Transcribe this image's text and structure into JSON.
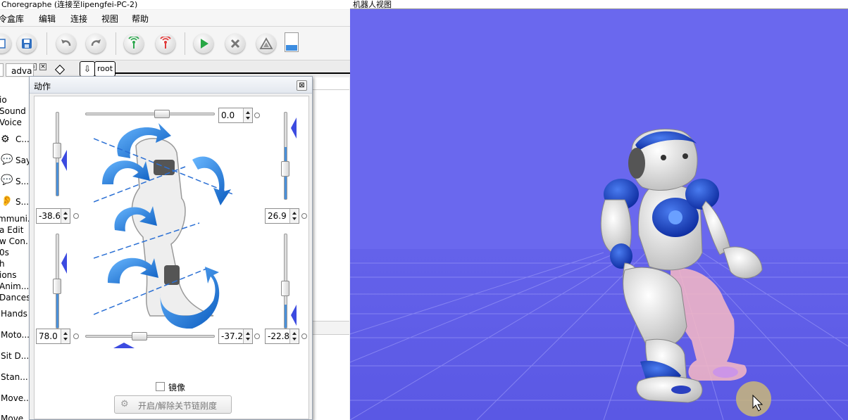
{
  "app": {
    "title": "Choregraphe (连接至lipengfei-PC-2)"
  },
  "menu": {
    "items": [
      "令盒库",
      "编辑",
      "连接",
      "视图",
      "帮助"
    ]
  },
  "toolbar": {
    "icons": [
      "new-icon",
      "save-icon",
      "undo-icon",
      "redo-icon",
      "connect-icon",
      "disconnect-icon",
      "play-icon",
      "stop-icon",
      "debug-icon",
      "volume-icon"
    ],
    "colors": {
      "connect": "#2fa84f",
      "disconnect": "#e03a3a",
      "play": "#28a745"
    }
  },
  "tabs": {
    "partial_tab": "adva",
    "breadcrumb_root": "root"
  },
  "library_list": {
    "items": [
      "io",
      "Sound",
      "Voice",
      "C...",
      "Say",
      "S...",
      "S...",
      "mmuni...",
      "a Edit",
      "w Con...",
      "0s",
      "h",
      "ions",
      "Anim...",
      "Dances",
      "Hands",
      "Moto...",
      "Sit D...",
      "Stan...",
      "Move...",
      "Move..."
    ]
  },
  "motion_dialog": {
    "title": "动作",
    "head_yaw": "0.0",
    "head_pitch_left": "-38.6",
    "head_pitch_right": "26.9",
    "hip_left": "78.0",
    "ankle_value": "-37.2",
    "hip_right": "-22.8",
    "mirror_label": "镜像",
    "stiffness_button": "开启/解除关节链刚度"
  },
  "robot_view": {
    "title": "机器人视图",
    "background": "#6a68ee",
    "grid_color": "#8f8df5"
  }
}
